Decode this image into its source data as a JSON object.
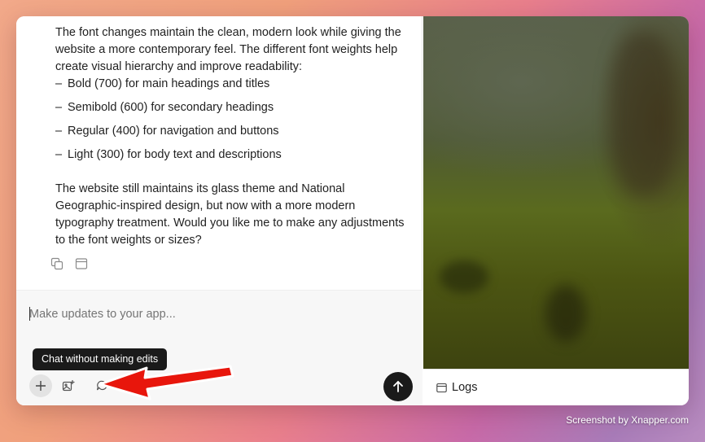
{
  "message": {
    "intro": "The font changes maintain the clean, modern look while giving the website a more contemporary feel. The different font weights help create visual hierarchy and improve readability:",
    "bullets": [
      "Bold (700) for main headings and titles",
      "Semibold (600) for secondary headings",
      "Regular (400) for navigation and buttons",
      "Light (300) for body text and descriptions"
    ],
    "bullet_dash": "–",
    "closing": "The website still maintains its glass theme and National Geographic-inspired design, but now with a more modern typography treatment. Would you like me to make any adjustments to the font weights or sizes?",
    "actions": [
      "copy-icon",
      "panel-icon"
    ]
  },
  "composer": {
    "placeholder": "Make updates to your app...",
    "tooltip": "Chat without making edits",
    "tools": [
      "plus-icon",
      "image-plus-icon",
      "chat-bubble-icon"
    ],
    "send_icon": "arrow-up-icon"
  },
  "preview": {
    "logs_label": "Logs",
    "logs_icon": "window-icon"
  },
  "annotation": {
    "arrow_color": "#e8160c"
  },
  "watermark": "Screenshot by Xnapper.com"
}
